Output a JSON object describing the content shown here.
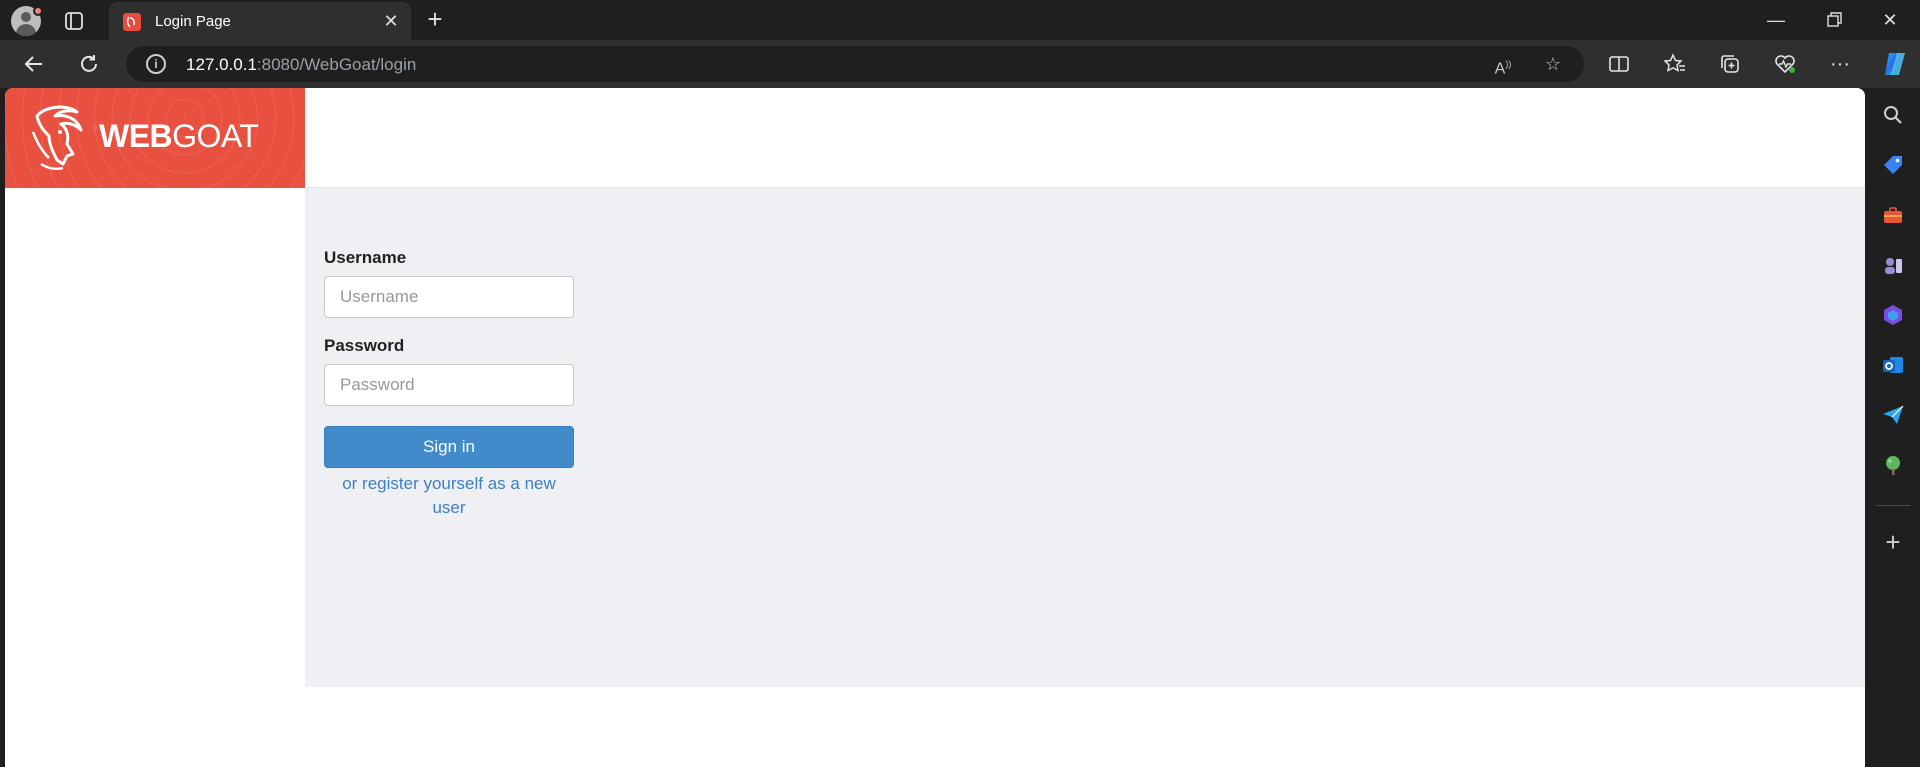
{
  "browser": {
    "tab": {
      "title": "Login Page"
    },
    "address": {
      "host": "127.0.0.1",
      "rest": ":8080/WebGoat/login"
    },
    "icons": [
      "profile-avatar",
      "tab-actions-icon",
      "close-icon",
      "new-tab-icon",
      "minimize-icon",
      "restore-icon",
      "window-close-icon",
      "back-icon",
      "refresh-icon",
      "site-info-icon",
      "read-aloud-icon",
      "favorite-star-icon",
      "split-screen-icon",
      "favorites-icon",
      "collections-icon",
      "browser-health-icon",
      "more-icon",
      "copilot-icon"
    ],
    "sidebar_icons": [
      "search-icon",
      "shopping-tag-icon",
      "tools-icon",
      "games-icon",
      "microsoft-365-icon",
      "outlook-icon",
      "send-icon",
      "tree-icon",
      "add-icon"
    ]
  },
  "page": {
    "logo": {
      "bold": "WEB",
      "light": "GOAT"
    },
    "login": {
      "username_label": "Username",
      "username_placeholder": "Username",
      "password_label": "Password",
      "password_placeholder": "Password",
      "submit_label": "Sign in",
      "register_text": "or register yourself as a new user"
    }
  },
  "colors": {
    "brand": "#e8503f",
    "primary_button": "#428bca",
    "link": "#3f7fc3",
    "content_bg": "#eff0f4"
  }
}
